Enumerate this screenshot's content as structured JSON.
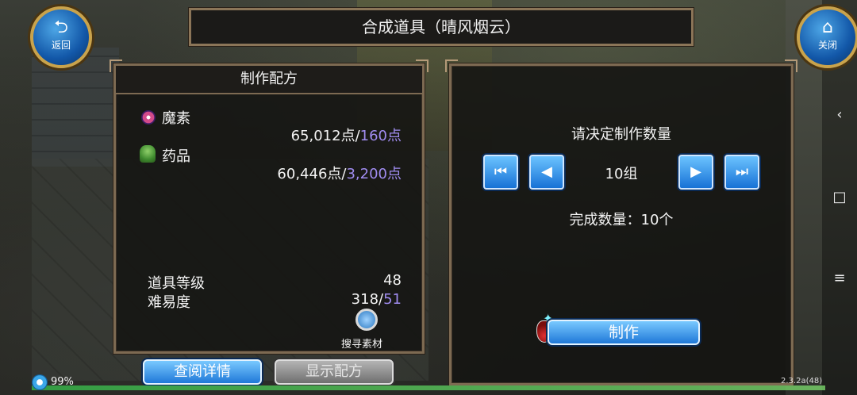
{
  "title": "合成道具（晴风烟云）",
  "back_button": {
    "label": "返回",
    "icon": "back-arrow-icon"
  },
  "close_button": {
    "label": "关闭",
    "icon": "house-icon"
  },
  "recipe_panel": {
    "heading": "制作配方",
    "materials": [
      {
        "name": "魔素",
        "have": "65,012点/",
        "need": "160点",
        "icon": "orb-icon",
        "color": "#d24a8a"
      },
      {
        "name": "药品",
        "have": "60,446点/",
        "need": "3,200点",
        "icon": "herb-icon",
        "color": "#5fae44"
      }
    ],
    "item_level_label": "道具等级",
    "item_level_value": "48",
    "difficulty_label": "难易度",
    "difficulty_have": "318/",
    "difficulty_need": "51",
    "search_label": "搜寻素材"
  },
  "quantity_panel": {
    "prompt": "请决定制作数量",
    "quantity": "10组",
    "completed_label": "完成数量：10个",
    "make_label": "制作",
    "first_icon": "skip-first-icon",
    "prev_icon": "prev-icon",
    "next_icon": "next-icon",
    "last_icon": "skip-last-icon"
  },
  "bottom_buttons": {
    "details": "查阅详情",
    "show_recipe": "显示配方"
  },
  "status": {
    "battery": "99%",
    "version": "2.3.2a(48)"
  },
  "colors": {
    "accent_blue": "#1f78d8",
    "need_value": "#a08cf0",
    "frame": "#7d6a52"
  }
}
